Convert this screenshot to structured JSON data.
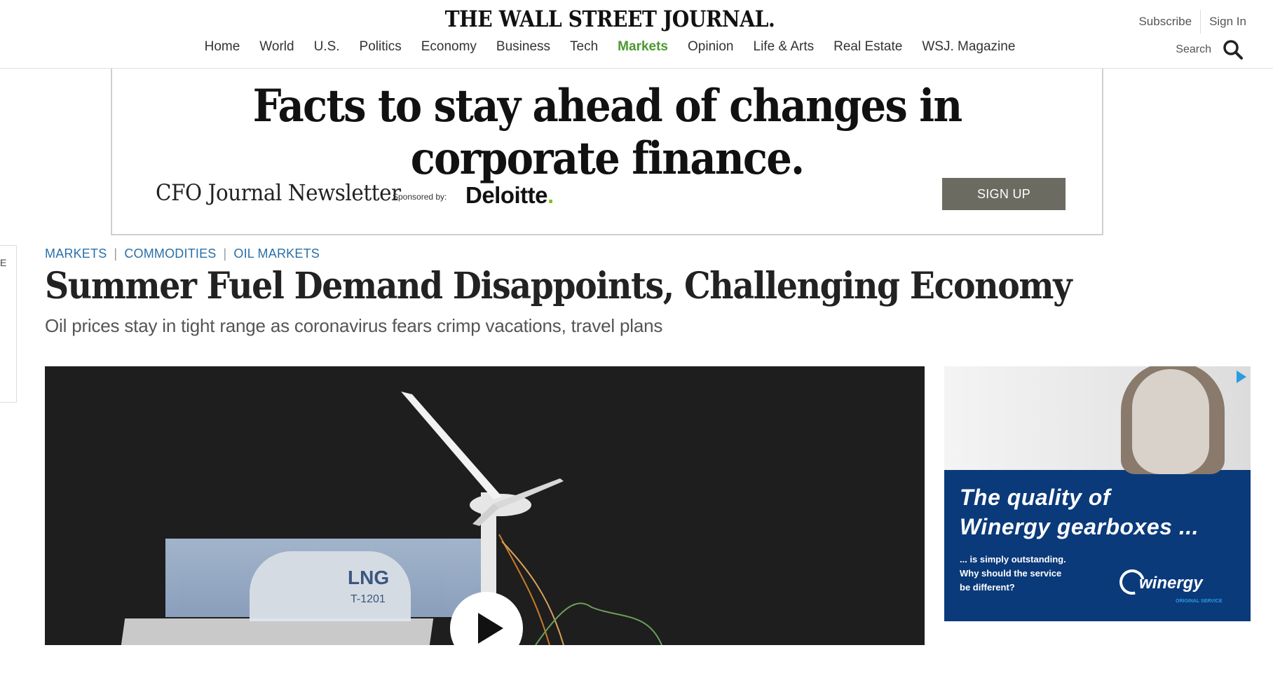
{
  "header": {
    "masthead": "THE WALL STREET JOURNAL.",
    "subscribe_label": "Subscribe",
    "signin_label": "Sign In",
    "search_label": "Search",
    "nav": [
      {
        "label": "Home",
        "active": false
      },
      {
        "label": "World",
        "active": false
      },
      {
        "label": "U.S.",
        "active": false
      },
      {
        "label": "Politics",
        "active": false
      },
      {
        "label": "Economy",
        "active": false
      },
      {
        "label": "Business",
        "active": false
      },
      {
        "label": "Tech",
        "active": false
      },
      {
        "label": "Markets",
        "active": true
      },
      {
        "label": "Opinion",
        "active": false
      },
      {
        "label": "Life & Arts",
        "active": false
      },
      {
        "label": "Real Estate",
        "active": false
      },
      {
        "label": "WSJ. Magazine",
        "active": false
      }
    ],
    "active_color": "#4a9a2e"
  },
  "ad_banner": {
    "headline": "Facts to stay ahead of changes in corporate finance.",
    "newsletter": "CFO Journal Newsletter",
    "sponsored_by": "Sponsored by:",
    "sponsor": "Deloitte",
    "sponsor_dot": ".",
    "signup_label": "SIGN UP"
  },
  "edge_tab": {
    "letter": "E"
  },
  "article": {
    "breadcrumb": [
      "MARKETS",
      "COMMODITIES",
      "OIL MARKETS"
    ],
    "breadcrumb_color": "#2a6fa8",
    "headline": "Summer Fuel Demand Disappoints, Challenging Economy",
    "dek": "Oil prices stay in tight range as coronavirus fears crimp vacations, travel plans"
  },
  "video": {
    "photo_label": "LNG",
    "photo_sublabel": "T-1201",
    "play_icon": "play-icon"
  },
  "side_ad": {
    "headline_line1": "The quality of",
    "headline_line2": "Winergy gearboxes ...",
    "sub_line1": "... is simply outstanding.",
    "sub_line2": "Why should the service",
    "sub_line3": "be different?",
    "brand": "winergy",
    "brand_sub": "ORIGINAL SERVICE",
    "background": "#0a3a7a"
  }
}
